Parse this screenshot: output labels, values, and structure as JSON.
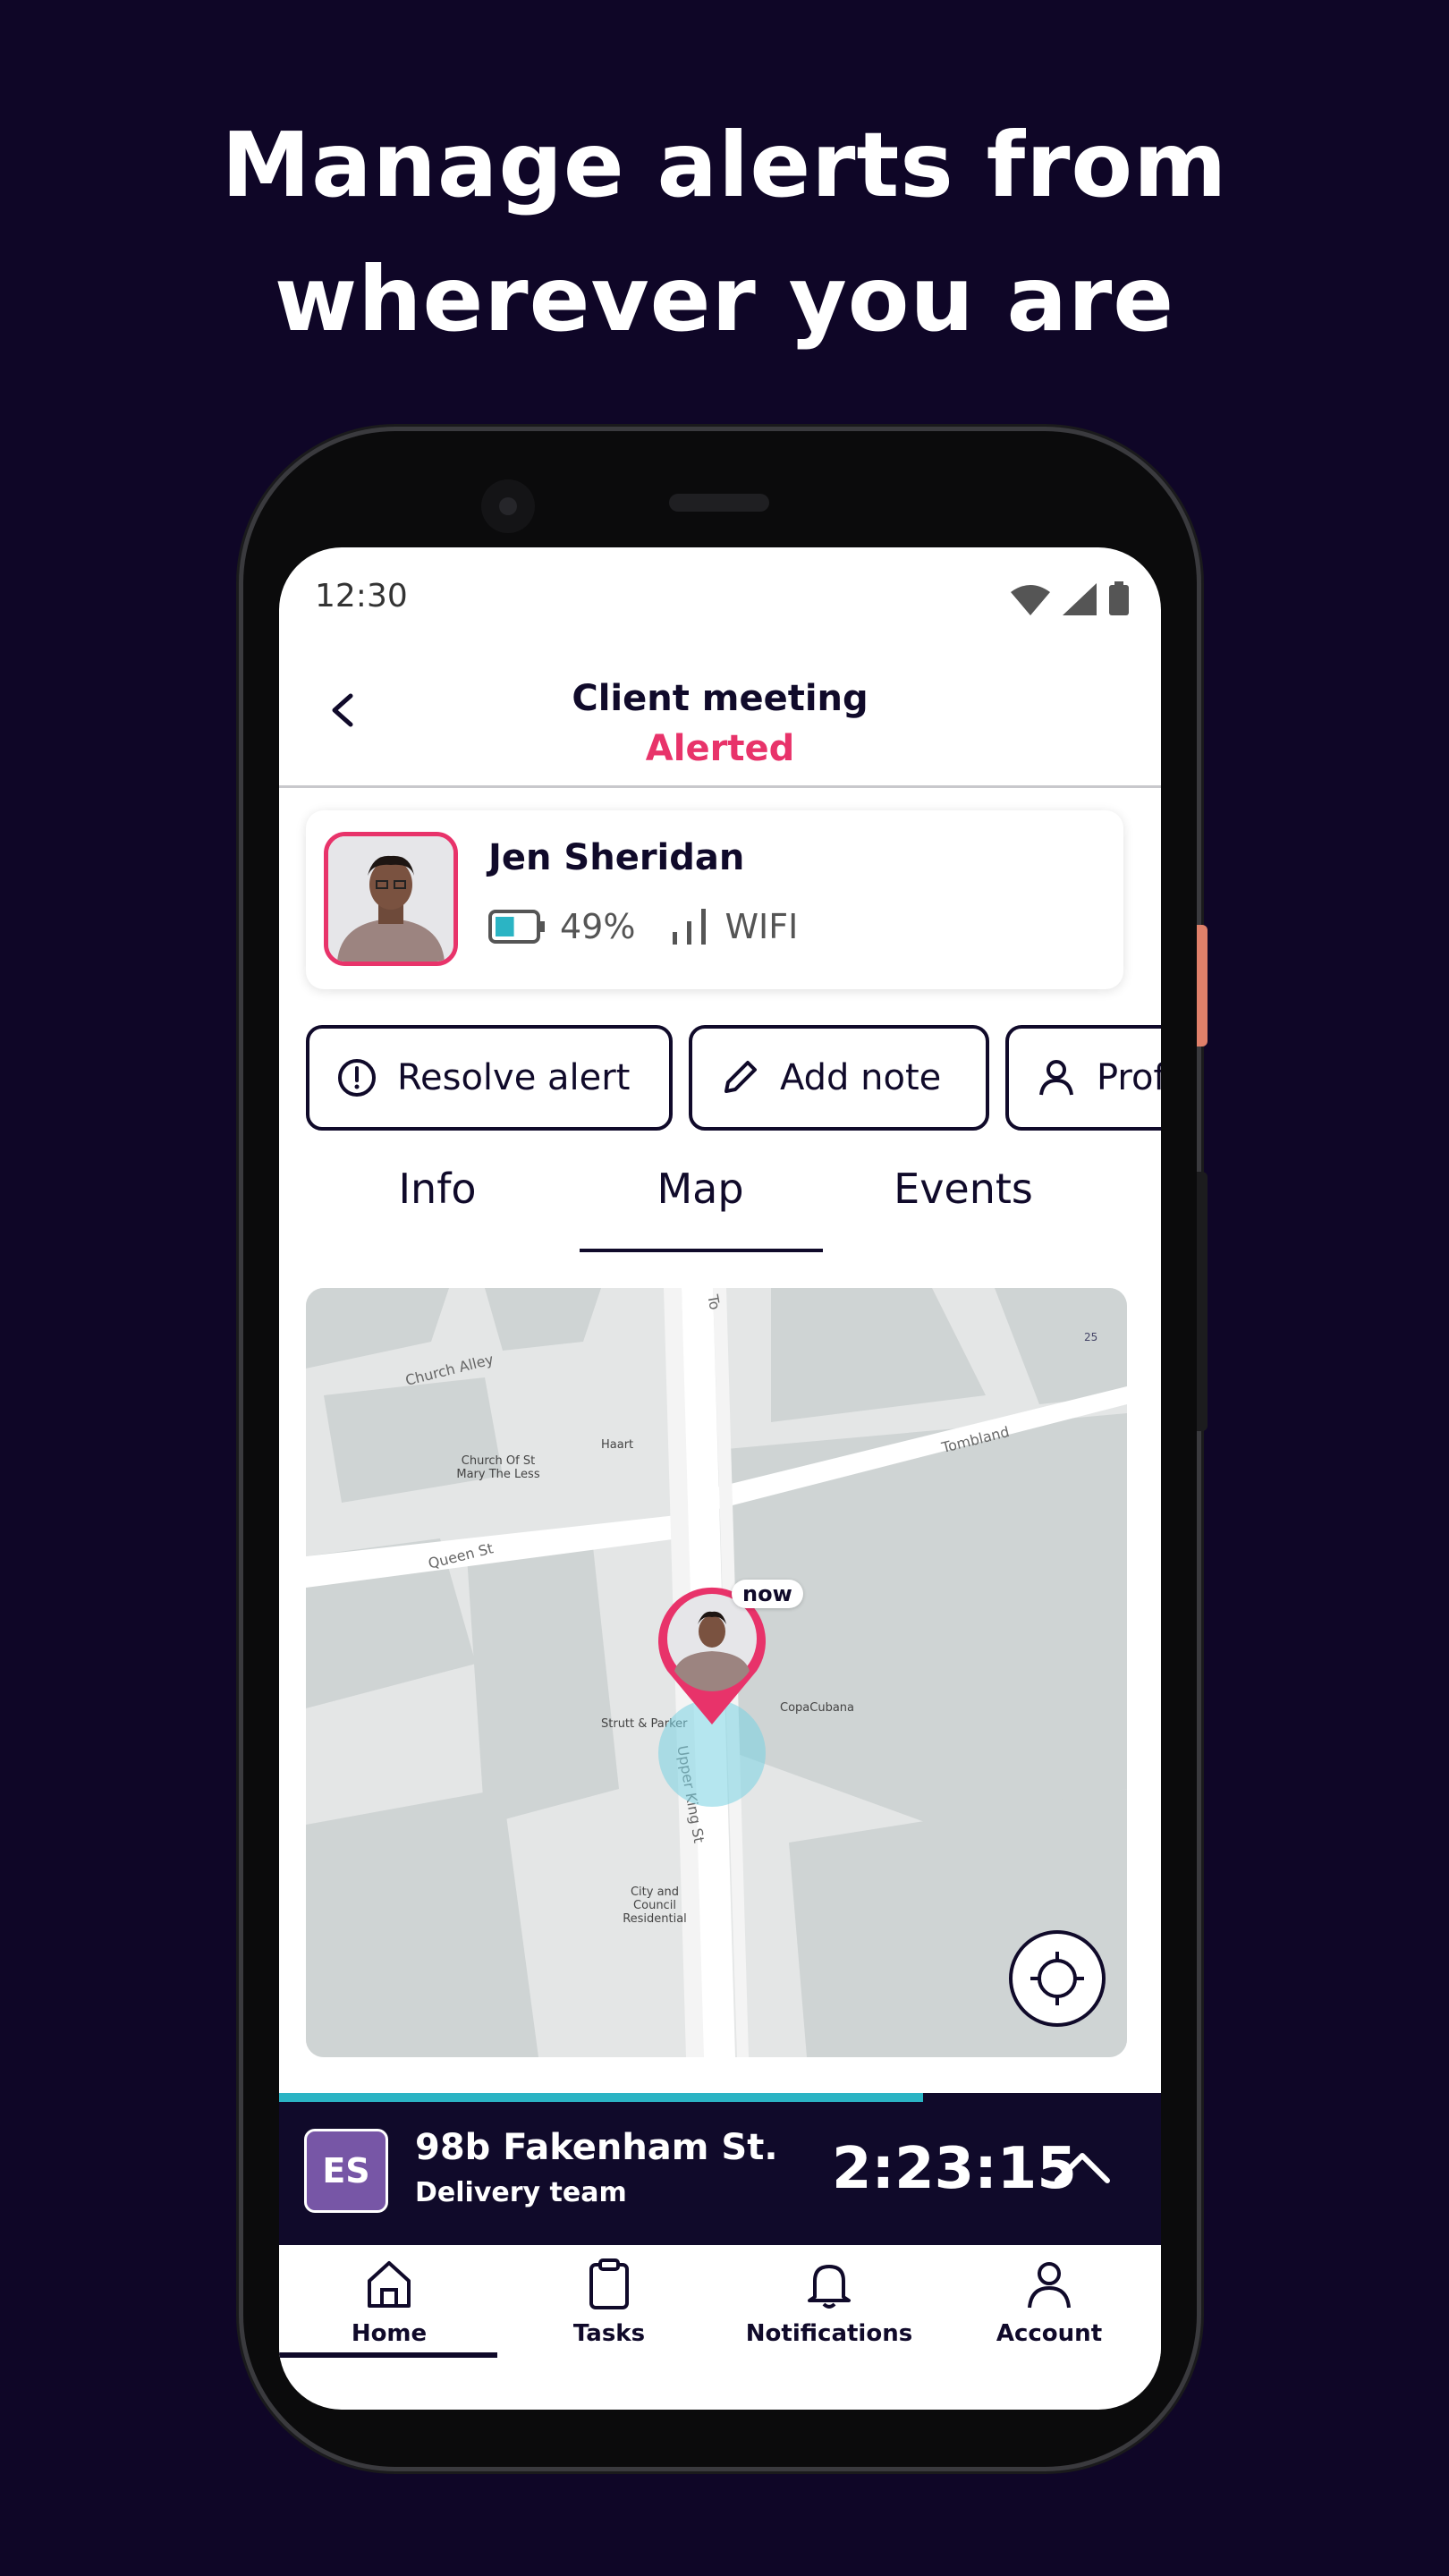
{
  "headline": {
    "line1": "Manage alerts from",
    "line2": "wherever you are"
  },
  "status_bar": {
    "time": "12:30"
  },
  "header": {
    "title": "Client meeting",
    "status": "Alerted",
    "back_icon": "chevron-left-icon"
  },
  "person": {
    "name": "Jen Sheridan",
    "battery": "49%",
    "connection": "WIFI",
    "battery_level": 0.49
  },
  "actions": [
    {
      "label": "Resolve alert",
      "icon": "alert-circle-icon"
    },
    {
      "label": "Add note",
      "icon": "pencil-icon"
    },
    {
      "label": "Profile",
      "icon": "user-icon"
    }
  ],
  "tabs": [
    {
      "label": "Info",
      "active": false
    },
    {
      "label": "Map",
      "active": true
    },
    {
      "label": "Events",
      "active": false
    }
  ],
  "map": {
    "marker_label": "now",
    "streets": [
      "Church Alley",
      "Queen St",
      "Tombland",
      "Upper King St",
      "To"
    ],
    "places": [
      "Church Of St Mary The Less",
      "Haart",
      "Strutt & Parker",
      "CopaCubana",
      "City and Council Residential",
      "25"
    ]
  },
  "session": {
    "initials": "ES",
    "location": "98b Fakenham St.",
    "team": "Delivery team",
    "timer": "2:23:15",
    "progress": 0.73
  },
  "nav": [
    {
      "label": "Home",
      "icon": "home-icon",
      "active": true
    },
    {
      "label": "Tasks",
      "icon": "clipboard-icon",
      "active": false
    },
    {
      "label": "Notifications",
      "icon": "bell-icon",
      "active": false
    },
    {
      "label": "Account",
      "icon": "user-icon",
      "active": false
    }
  ],
  "colors": {
    "background": "#0f0627",
    "accent": "#e8336a",
    "navy": "#100a2a",
    "teal": "#2bb4c4",
    "purple": "#7756a6"
  }
}
